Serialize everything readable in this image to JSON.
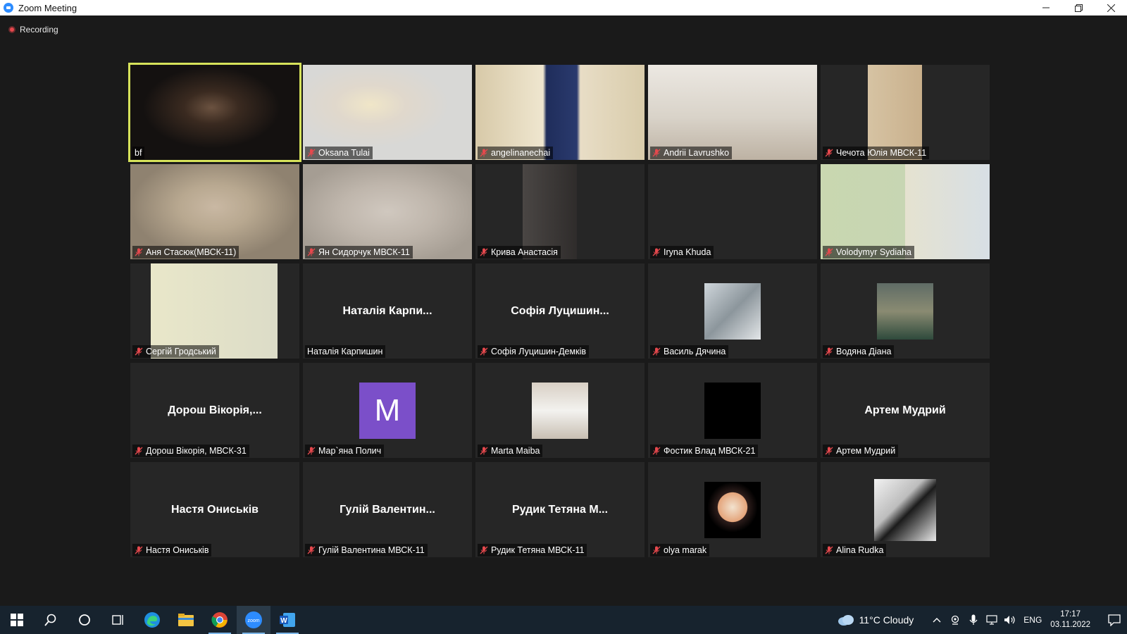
{
  "window": {
    "title": "Zoom Meeting",
    "controls": [
      "minimize",
      "restore",
      "close"
    ]
  },
  "recording": {
    "label": "Recording"
  },
  "colors": {
    "active_speaker_border": "#d6e25a",
    "muted_icon": "#e5484d",
    "letter_avatar_bg": "#7b4fc9",
    "background": "#1a1a1a",
    "tile_bg": "#262626"
  },
  "participants": [
    {
      "name": "bf",
      "muted": false,
      "display": "video",
      "active": true
    },
    {
      "name": "Oksana Tulai",
      "muted": true,
      "display": "video"
    },
    {
      "name": "angelinanechai",
      "muted": true,
      "display": "video"
    },
    {
      "name": "Andrii Lavrushko",
      "muted": true,
      "display": "video"
    },
    {
      "name": "Чечота Юлія МВСК-11",
      "muted": true,
      "display": "video"
    },
    {
      "name": "Аня Стасюк(МВСК-11)",
      "muted": true,
      "display": "video"
    },
    {
      "name": "Ян Сидорчук МВСК-11",
      "muted": true,
      "display": "video"
    },
    {
      "name": "Крива Анастасія",
      "muted": true,
      "display": "video"
    },
    {
      "name": "Iryna Khuda",
      "muted": true,
      "display": "off"
    },
    {
      "name": "Volodymyr Sydiaha",
      "muted": true,
      "display": "video"
    },
    {
      "name": "Сергій Гродський",
      "muted": true,
      "display": "video"
    },
    {
      "name": "Наталія Карпишин",
      "muted": false,
      "display": "name",
      "center": "Наталія Карпи..."
    },
    {
      "name": "Софія Луцишин-Демків",
      "muted": true,
      "display": "name",
      "center": "Софія Луцишин..."
    },
    {
      "name": "Василь Дячина",
      "muted": true,
      "display": "photo"
    },
    {
      "name": "Водяна Діана",
      "muted": true,
      "display": "photo"
    },
    {
      "name": "Дорош Вікорія, МВСК-31",
      "muted": true,
      "display": "name",
      "center": "Дорош Вікорія,..."
    },
    {
      "name": "Мар`яна Полич",
      "muted": true,
      "display": "letter",
      "letter": "M"
    },
    {
      "name": "Marta Maiba",
      "muted": true,
      "display": "photo"
    },
    {
      "name": "Фостик Влад МВСК-21",
      "muted": true,
      "display": "photo"
    },
    {
      "name": "Артем Мудрий",
      "muted": true,
      "display": "name",
      "center": "Артем Мудрий"
    },
    {
      "name": "Настя Ониськів",
      "muted": true,
      "display": "name",
      "center": "Настя Ониськів"
    },
    {
      "name": "Гулій Валентина МВСК-11",
      "muted": true,
      "display": "name",
      "center": "Гулій Валентин..."
    },
    {
      "name": "Рудик Тетяна МВСК-11",
      "muted": true,
      "display": "name",
      "center": "Рудик Тетяна М..."
    },
    {
      "name": "olya marak",
      "muted": true,
      "display": "photo"
    },
    {
      "name": "Alina Rudka",
      "muted": true,
      "display": "photo"
    }
  ],
  "taskbar": {
    "apps": [
      "start-icon",
      "search-icon",
      "cortana-icon",
      "task-view-icon",
      "edge-icon",
      "file-explorer-icon",
      "chrome-icon",
      "zoom-icon",
      "word-icon"
    ],
    "weather": "11°C  Cloudy",
    "language": "ENG",
    "time": "17:17",
    "date": "03.11.2022"
  }
}
